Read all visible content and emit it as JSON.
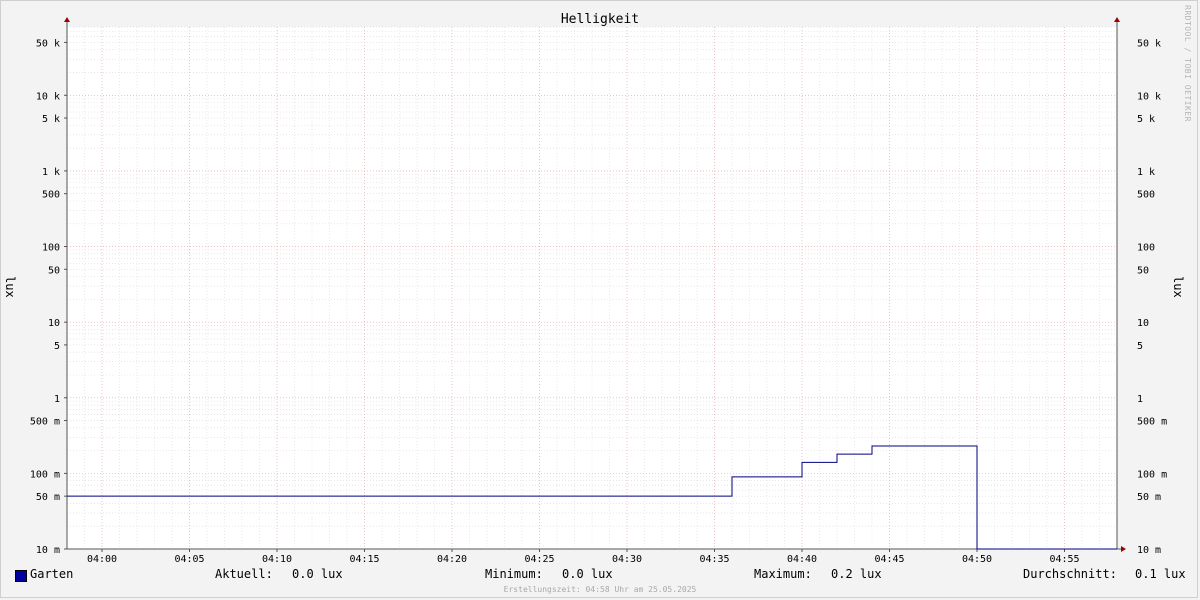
{
  "chart_data": {
    "type": "line",
    "title": "Helligkeit",
    "ylabel": "lux",
    "y_scale": "log",
    "ylim": [
      0.01,
      80000
    ],
    "y_ticks": [
      {
        "value": 50000,
        "label": "50 k"
      },
      {
        "value": 10000,
        "label": "10 k"
      },
      {
        "value": 5000,
        "label": "5 k"
      },
      {
        "value": 1000,
        "label": "1 k"
      },
      {
        "value": 500,
        "label": "500"
      },
      {
        "value": 100,
        "label": "100"
      },
      {
        "value": 50,
        "label": "50"
      },
      {
        "value": 10,
        "label": "10"
      },
      {
        "value": 5,
        "label": "5"
      },
      {
        "value": 1,
        "label": "1"
      },
      {
        "value": 0.5,
        "label": "500 m"
      },
      {
        "value": 0.1,
        "label": "100 m"
      },
      {
        "value": 0.05,
        "label": "50 m"
      },
      {
        "value": 0.01,
        "label": "10 m"
      }
    ],
    "xlim": [
      "03:58",
      "04:58"
    ],
    "x_ticks": [
      "04:00",
      "04:05",
      "04:10",
      "04:15",
      "04:20",
      "04:25",
      "04:30",
      "04:35",
      "04:40",
      "04:45",
      "04:50",
      "04:55"
    ],
    "grid": true,
    "series": [
      {
        "name": "Garten",
        "color": "#000080",
        "step": true,
        "points": [
          {
            "t": "03:58",
            "v": 0.05
          },
          {
            "t": "04:36",
            "v": 0.09
          },
          {
            "t": "04:40",
            "v": 0.14
          },
          {
            "t": "04:42",
            "v": 0.18
          },
          {
            "t": "04:44",
            "v": 0.23
          },
          {
            "t": "04:50",
            "v": 0.01
          },
          {
            "t": "04:58",
            "v": 0.01
          }
        ]
      }
    ]
  },
  "legend": {
    "series_name": "Garten",
    "swatch_color": "#0000a0",
    "current_label": "Aktuell:",
    "current_value": "0.0 lux",
    "min_label": "Minimum:",
    "min_value": "0.0 lux",
    "max_label": "Maximum:",
    "max_value": "0.2 lux",
    "avg_label": "Durchschnitt:",
    "avg_value": "0.1 lux"
  },
  "footer": "Erstellungszeit: 04:58 Uhr am 25.05.2025",
  "watermark": "RRDTOOL / TOBI OETIKER"
}
